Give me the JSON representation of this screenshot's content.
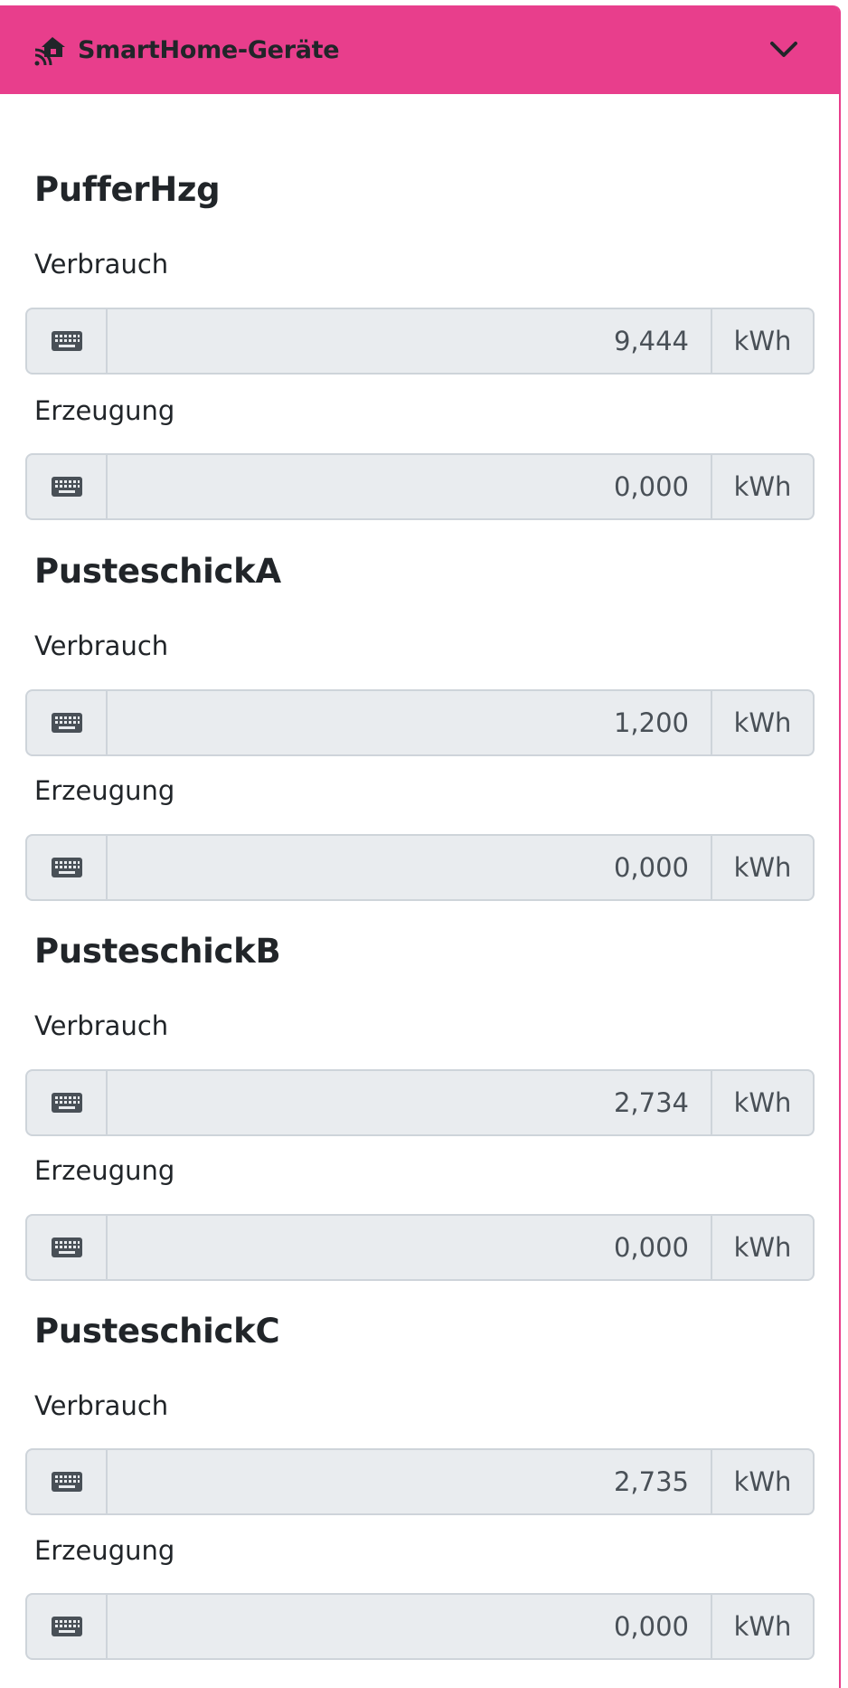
{
  "header": {
    "title": "SmartHome-Geräte",
    "icon": "smarthome-icon",
    "toggle_icon": "chevron-down-icon",
    "accent_color": "#e83e8c"
  },
  "devices": [
    {
      "name": "PufferHzg",
      "fields": [
        {
          "label": "Verbrauch",
          "value": "9,444",
          "unit": "kWh"
        },
        {
          "label": "Erzeugung",
          "value": "0,000",
          "unit": "kWh"
        }
      ]
    },
    {
      "name": "PusteschickA",
      "fields": [
        {
          "label": "Verbrauch",
          "value": "1,200",
          "unit": "kWh"
        },
        {
          "label": "Erzeugung",
          "value": "0,000",
          "unit": "kWh"
        }
      ]
    },
    {
      "name": "PusteschickB",
      "fields": [
        {
          "label": "Verbrauch",
          "value": "2,734",
          "unit": "kWh"
        },
        {
          "label": "Erzeugung",
          "value": "0,000",
          "unit": "kWh"
        }
      ]
    },
    {
      "name": "PusteschickC",
      "fields": [
        {
          "label": "Verbrauch",
          "value": "2,735",
          "unit": "kWh"
        },
        {
          "label": "Erzeugung",
          "value": "0,000",
          "unit": "kWh"
        }
      ]
    }
  ],
  "field_icon": "keyboard-icon"
}
